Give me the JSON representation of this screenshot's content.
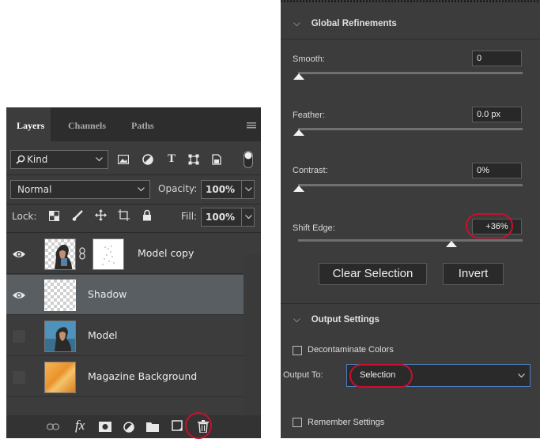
{
  "layers_panel": {
    "tabs": [
      "Layers",
      "Channels",
      "Paths"
    ],
    "filter": {
      "kind_label": "Kind"
    },
    "blend_mode": "Normal",
    "opacity_label": "Opacity:",
    "opacity_value": "100%",
    "lock_label": "Lock:",
    "fill_label": "Fill:",
    "fill_value": "100%",
    "layers": [
      {
        "name": "Model copy",
        "visible": true,
        "selected": false,
        "has_mask": true
      },
      {
        "name": "Shadow",
        "visible": true,
        "selected": true,
        "has_mask": false
      },
      {
        "name": "Model",
        "visible": false,
        "selected": false,
        "has_mask": false
      },
      {
        "name": "Magazine Background",
        "visible": false,
        "selected": false,
        "has_mask": false
      }
    ],
    "footer_icons": [
      "link-layers-icon",
      "fx-icon",
      "add-mask-icon",
      "adjustment-layer-icon",
      "new-group-icon",
      "new-layer-icon",
      "delete-layer-icon"
    ],
    "highlighted_footer_icon": "new-layer-icon"
  },
  "refine_panel": {
    "global_refinements": {
      "title": "Global Refinements",
      "sliders": [
        {
          "label": "Smooth:",
          "value": "0",
          "position": 0
        },
        {
          "label": "Feather:",
          "value": "0.0 px",
          "position": 0
        },
        {
          "label": "Contrast:",
          "value": "0%",
          "position": 0
        },
        {
          "label": "Shift Edge:",
          "value": "+36%",
          "position": 0.68
        }
      ],
      "clear_button": "Clear Selection",
      "invert_button": "Invert"
    },
    "output_settings": {
      "title": "Output Settings",
      "decontaminate_label": "Decontaminate Colors",
      "decontaminate_checked": false,
      "output_to_label": "Output To:",
      "output_to_value": "Selection",
      "remember_label": "Remember Settings",
      "remember_checked": false
    },
    "highlight_color": "#c8102e"
  }
}
